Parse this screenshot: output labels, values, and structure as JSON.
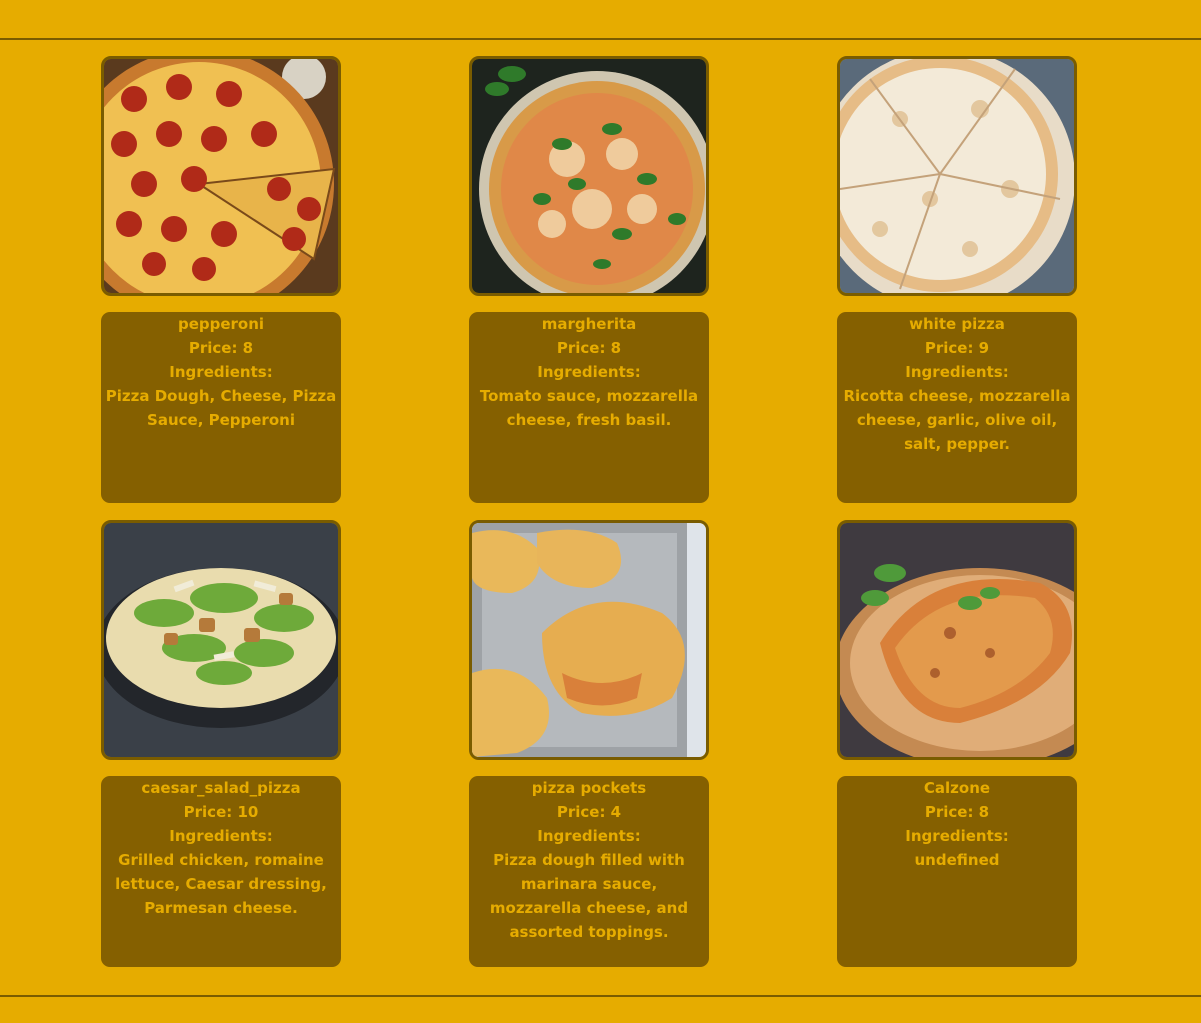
{
  "pizzas": [
    {
      "name": "pepperoni",
      "price": "Price: 8",
      "ingredients_label": "Ingredients:",
      "ingredients": "Pizza Dough, Cheese, Pizza Sauce, Pepperoni",
      "image": "pepperoni-pizza-photo"
    },
    {
      "name": "margherita",
      "price": "Price: 8",
      "ingredients_label": "Ingredients:",
      "ingredients": "Tomato sauce, mozzarella cheese, fresh basil.",
      "image": "margherita-pizza-photo"
    },
    {
      "name": "white pizza",
      "price": "Price: 9",
      "ingredients_label": "Ingredients:",
      "ingredients": "Ricotta cheese, mozzarella cheese, garlic, olive oil, salt, pepper.",
      "image": "white-pizza-photo"
    },
    {
      "name": "caesar_salad_pizza",
      "price": "Price: 10",
      "ingredients_label": "Ingredients:",
      "ingredients": "Grilled chicken, romaine lettuce, Caesar dressing, Parmesan cheese.",
      "image": "caesar-salad-pizza-photo"
    },
    {
      "name": "pizza pockets",
      "price": "Price: 4",
      "ingredients_label": "Ingredients:",
      "ingredients": "Pizza dough filled with marinara sauce, mozzarella cheese, and assorted toppings.",
      "image": "pizza-pockets-photo"
    },
    {
      "name": "Calzone",
      "price": "Price: 8",
      "ingredients_label": "Ingredients:",
      "ingredients": "undefined",
      "image": "calzone-photo"
    }
  ],
  "colors": {
    "background": "#e6ac00",
    "card": "#856000",
    "text": "#e6ac00",
    "border": "#7a5c00"
  }
}
